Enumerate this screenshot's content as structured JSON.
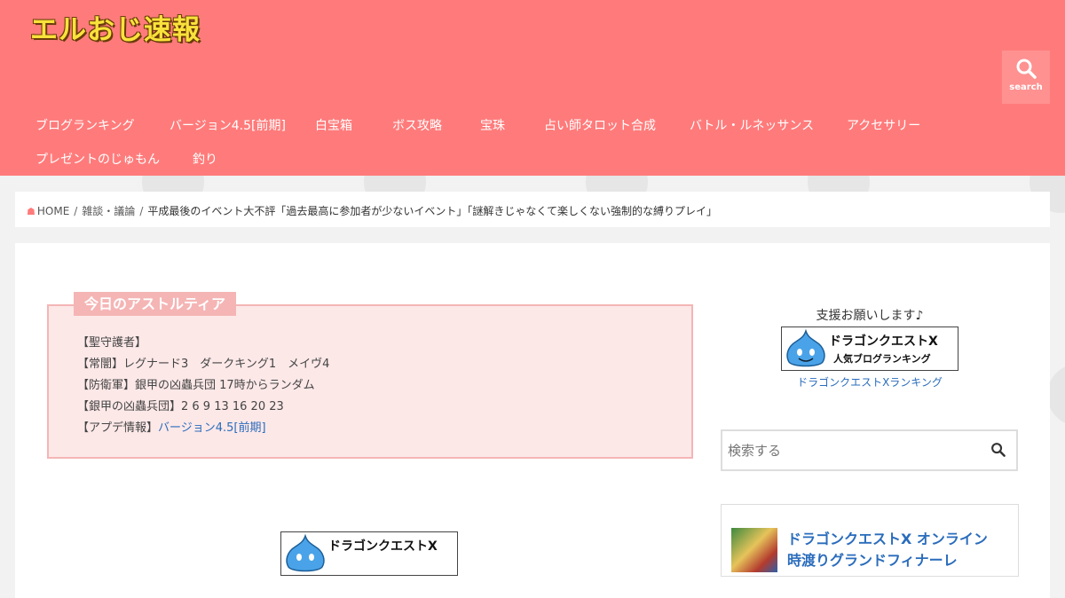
{
  "site": {
    "logo": "エルおじ速報"
  },
  "header": {
    "search_label": "search"
  },
  "nav": [
    "ブログランキング",
    "バージョン4.5[前期]",
    "白宝箱",
    "ボス攻略",
    "宝珠",
    "占い師タロット合成",
    "バトル・ルネッサンス",
    "アクセサリー",
    "プレゼントのじゅもん",
    "釣り"
  ],
  "breadcrumb": {
    "home": "HOME",
    "category": "雑談・議論",
    "current": "平成最後のイベント大不評「過去最高に参加者が少ないイベント」「謎解きじゃなくて楽しくない強制的な縛りプレイ」"
  },
  "astoltia": {
    "title": "今日のアストルティア",
    "lines": [
      "【聖守護者】",
      "【常闇】レグナード3　ダークキング1　メイヴ4",
      "【防衛軍】銀甲の凶蟲兵団 17時からランダム",
      "【銀甲の凶蟲兵団】2 6 9 13 16 20 23"
    ],
    "update_prefix": "【アプデ情報】",
    "update_link": "バージョン4.5[前期]"
  },
  "sidebar": {
    "support_text": "支援お願いします♪",
    "banner_line1": "ドラゴンクエストX",
    "banner_line2": "人気ブログランキング",
    "ranking_link": "ドラゴンクエストXランキング",
    "search_placeholder": "検索する",
    "ad_title_line1": "ドラゴンクエストX オンライン",
    "ad_title_line2": "時渡りグランドフィナーレ"
  },
  "colors": {
    "header_bg": "#ff7b7b",
    "logo": "#f9e23b",
    "link": "#2a6cbc",
    "box_bg": "#fde8e8",
    "box_border": "#f5b5b5"
  }
}
